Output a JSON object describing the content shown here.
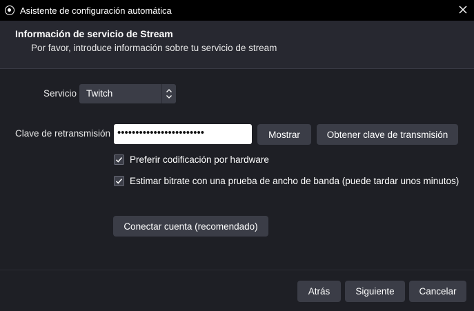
{
  "window": {
    "title": "Asistente de configuración automática"
  },
  "header": {
    "title": "Información de servicio de Stream",
    "subtitle": "Por favor, introduce información sobre tu servicio de stream"
  },
  "form": {
    "service_label": "Servicio",
    "service_value": "Twitch",
    "stream_key_label": "Clave de retransmisión",
    "stream_key_value": "••••••••••••••••••••••••",
    "show_button": "Mostrar",
    "get_key_button": "Obtener clave de transmisión",
    "hardware_encoding_label": "Preferir codificación por hardware",
    "hardware_encoding_checked": true,
    "bandwidth_test_label": "Estimar bitrate con una prueba de ancho de banda (puede tardar unos minutos)",
    "bandwidth_test_checked": true,
    "connect_account_button": "Conectar cuenta (recomendado)"
  },
  "footer": {
    "back_button": "Atrás",
    "next_button": "Siguiente",
    "cancel_button": "Cancelar"
  },
  "colors": {
    "window_bg": "#1e1f25",
    "header_bg": "#272830",
    "button_bg": "#3b3d47",
    "titlebar_bg": "#000000"
  }
}
